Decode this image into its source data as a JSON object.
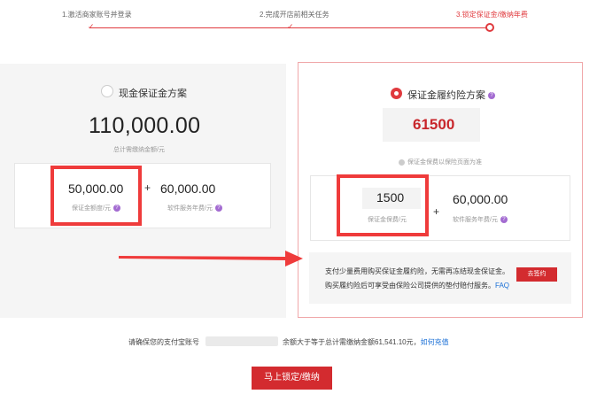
{
  "steps": [
    {
      "label": "1.激活商家账号并登录"
    },
    {
      "label": "2.完成开店前相关任务"
    },
    {
      "label": "3.锁定保证金/缴纳年费"
    }
  ],
  "cash_plan": {
    "title": "现金保证金方案",
    "total_amount": "110,000.00",
    "total_caption": "总计需缴纳金额/元",
    "deposit_amount": "50,000.00",
    "deposit_caption": "保证金额度/元",
    "service_fee": "60,000.00",
    "service_caption": "软件服务年费/元",
    "plus": "+"
  },
  "insurance_plan": {
    "title": "保证金履约险方案",
    "total_amount": "61500",
    "total_note": "保证金保费以保险页面为准",
    "premium_amount": "1500",
    "premium_caption": "保证金保费/元",
    "service_fee": "60,000.00",
    "service_caption": "软件服务年费/元",
    "plus": "+",
    "notice_line1": "支付少量费用购买保证金履约险，无需再冻结现金保证金。",
    "notice_line2": "购买履约险后可享受由保险公司提供的垫付赔付服务。",
    "faq_label": "FAQ",
    "sign_button": "去签约"
  },
  "footer": {
    "prefix": "请确保您的支付宝账号",
    "suffix": "余额大于等于总计需缴纳金额61,541.10元，",
    "link": "如何充值",
    "lock_button": "马上锁定/缴纳"
  },
  "colors": {
    "accent": "#e03a3e",
    "highlight": "#ef3b3b",
    "link": "#1a6fd6",
    "help": "#a36bd1"
  }
}
